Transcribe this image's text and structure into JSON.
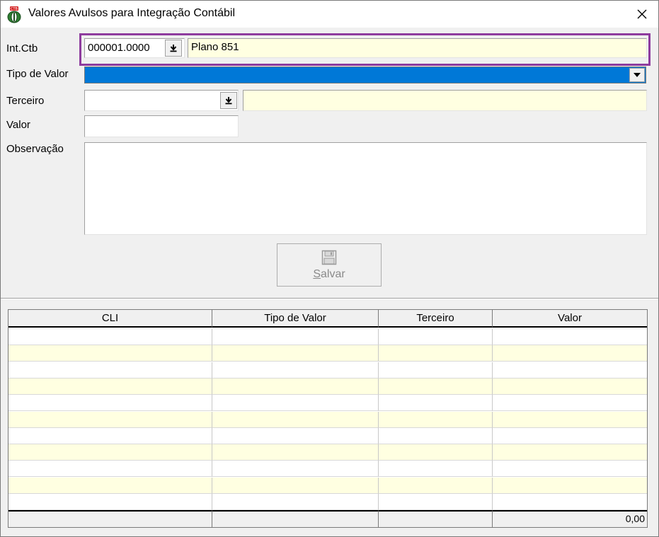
{
  "window": {
    "title": "Valores Avulsos para Integração Contábil",
    "close_symbol": "✕",
    "app_icon": "ctb-app-icon"
  },
  "form": {
    "intctb_label": "Int.Ctb",
    "intctb_code": "000001.0000",
    "intctb_desc": "Plano 851",
    "tipo_label": "Tipo de Valor",
    "terceiro_label": "Terceiro",
    "terceiro_code": "",
    "terceiro_desc": "",
    "valor_label": "Valor",
    "valor_value": "",
    "obs_label": "Observação",
    "obs_value": "",
    "save_label": "Salvar",
    "save_icon": "floppy-disk-icon"
  },
  "grid": {
    "columns": [
      "CLI",
      "Tipo de Valor",
      "Terceiro",
      "Valor"
    ],
    "rows": [
      [
        "",
        "",
        "",
        ""
      ],
      [
        "",
        "",
        "",
        ""
      ],
      [
        "",
        "",
        "",
        ""
      ],
      [
        "",
        "",
        "",
        ""
      ],
      [
        "",
        "",
        "",
        ""
      ],
      [
        "",
        "",
        "",
        ""
      ],
      [
        "",
        "",
        "",
        ""
      ],
      [
        "",
        "",
        "",
        ""
      ],
      [
        "",
        "",
        "",
        ""
      ],
      [
        "",
        "",
        "",
        ""
      ],
      [
        "",
        "",
        "",
        ""
      ]
    ],
    "footer_total": "0,00"
  },
  "colors": {
    "highlight_border": "#8e3c9e",
    "selection_blue": "#0078d7",
    "readonly_yellow": "#ffffe1"
  }
}
